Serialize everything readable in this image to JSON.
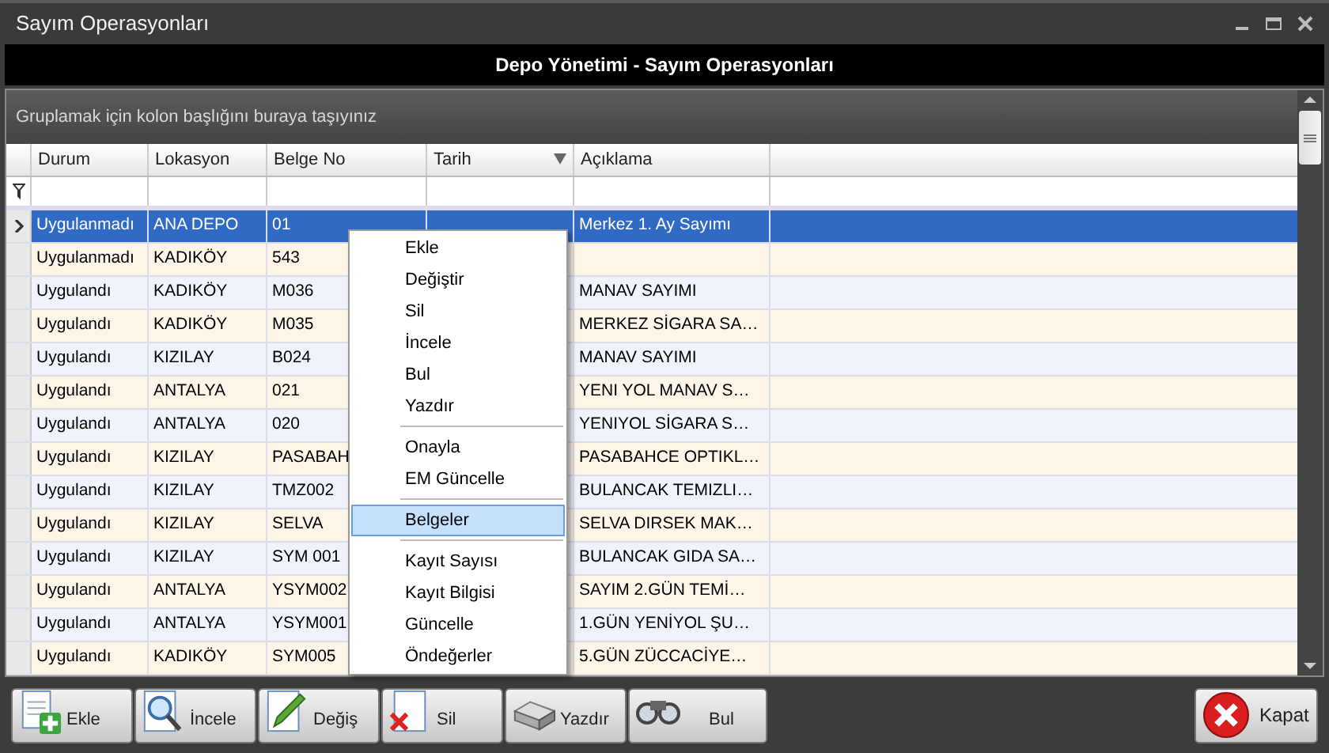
{
  "window": {
    "title": "Sayım Operasyonları"
  },
  "header": {
    "title": "Depo Yönetimi - Sayım Operasyonları"
  },
  "group_panel": {
    "placeholder": "Gruplamak için kolon başlığını buraya taşıyınız"
  },
  "grid": {
    "columns": [
      {
        "label": "Durum",
        "sorted": false
      },
      {
        "label": "Lokasyon",
        "sorted": false
      },
      {
        "label": "Belge No",
        "sorted": false
      },
      {
        "label": "Tarih",
        "sorted": true
      },
      {
        "label": "Açıklama",
        "sorted": false
      }
    ],
    "rows": [
      {
        "selected": true,
        "durum": "Uygulanmadı",
        "lokasyon": "ANA DEPO",
        "belge_no": "01",
        "aciklama": "Merkez 1. Ay Sayımı"
      },
      {
        "selected": false,
        "durum": "Uygulanmadı",
        "lokasyon": "KADIKÖY",
        "belge_no": "543"
      },
      {
        "selected": false,
        "durum": "Uygulandı",
        "lokasyon": "KADIKÖY",
        "belge_no": "M036",
        "aciklama": "MANAV SAYIMI"
      },
      {
        "selected": false,
        "durum": "Uygulandı",
        "lokasyon": "KADIKÖY",
        "belge_no": "M035",
        "aciklama": "MERKEZ SİGARA SA…"
      },
      {
        "selected": false,
        "durum": "Uygulandı",
        "lokasyon": "KIZILAY",
        "belge_no": "B024",
        "aciklama": "MANAV SAYIMI"
      },
      {
        "selected": false,
        "durum": "Uygulandı",
        "lokasyon": "ANTALYA",
        "belge_no": "021",
        "aciklama": "YENI YOL MANAV S…"
      },
      {
        "selected": false,
        "durum": "Uygulandı",
        "lokasyon": "ANTALYA",
        "belge_no": "020",
        "aciklama": "YENIYOL SİGARA S…"
      },
      {
        "selected": false,
        "durum": "Uygulandı",
        "lokasyon": "KIZILAY",
        "belge_no": "PASABAH",
        "aciklama": "PASABAHCE OPTIKL…"
      },
      {
        "selected": false,
        "durum": "Uygulandı",
        "lokasyon": "KIZILAY",
        "belge_no": "TMZ002",
        "aciklama": "BULANCAK TEMIZLI…"
      },
      {
        "selected": false,
        "durum": "Uygulandı",
        "lokasyon": "KIZILAY",
        "belge_no": "SELVA",
        "aciklama": "SELVA DIRSEK MAK…"
      },
      {
        "selected": false,
        "durum": "Uygulandı",
        "lokasyon": "KIZILAY",
        "belge_no": "SYM 001",
        "aciklama": "BULANCAK GIDA SA…"
      },
      {
        "selected": false,
        "durum": "Uygulandı",
        "lokasyon": "ANTALYA",
        "belge_no": "YSYM002",
        "aciklama": "SAYIM 2.GÜN TEMİ…"
      },
      {
        "selected": false,
        "durum": "Uygulandı",
        "lokasyon": "ANTALYA",
        "belge_no": "YSYM001",
        "aciklama": "1.GÜN YENİYOL ŞU…"
      },
      {
        "selected": false,
        "durum": "Uygulandı",
        "lokasyon": "KADIKÖY",
        "belge_no": "SYM005",
        "aciklama": "5.GÜN ZÜCCACİYE…"
      }
    ]
  },
  "context_menu": {
    "groups": [
      [
        {
          "label": "Ekle",
          "selected": false
        },
        {
          "label": "Değiştir",
          "selected": false
        },
        {
          "label": "Sil",
          "selected": false
        },
        {
          "label": "İncele",
          "selected": false
        },
        {
          "label": "Bul",
          "selected": false
        },
        {
          "label": "Yazdır",
          "selected": false
        }
      ],
      [
        {
          "label": "Onayla",
          "selected": false
        },
        {
          "label": "EM Güncelle",
          "selected": false
        }
      ],
      [
        {
          "label": "Belgeler",
          "selected": true
        }
      ],
      [
        {
          "label": "Kayıt Sayısı",
          "selected": false
        },
        {
          "label": "Kayıt Bilgisi",
          "selected": false
        },
        {
          "label": "Güncelle",
          "selected": false
        },
        {
          "label": "Öndeğerler",
          "selected": false
        }
      ]
    ]
  },
  "toolbar": {
    "buttons": [
      {
        "label": "Ekle",
        "kind": "add"
      },
      {
        "label": "İncele",
        "kind": "inspect"
      },
      {
        "label": "Değiş",
        "kind": "edit"
      },
      {
        "label": "Sil",
        "kind": "delete"
      },
      {
        "label": "Yazdır",
        "kind": "print"
      },
      {
        "label": "Bul",
        "kind": "find"
      }
    ],
    "close": {
      "label": "Kapat"
    }
  }
}
